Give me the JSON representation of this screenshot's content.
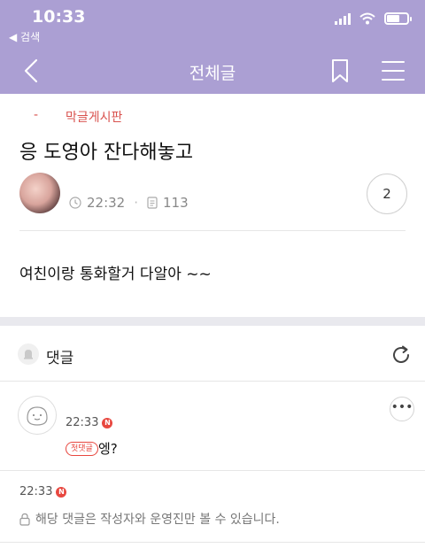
{
  "status_bar": {
    "time": "10:33",
    "back_app": "◀ 검색"
  },
  "navbar": {
    "title": "전체글"
  },
  "post": {
    "category_dash": "-",
    "category": "막글게시판",
    "title": "응 도영아 잔다해놓고",
    "time": "22:32",
    "views": "113",
    "comment_count": "2",
    "body": "여친이랑 통화할거 다알아 ~~"
  },
  "comments": {
    "header_label": "댓글",
    "items": [
      {
        "time": "22:33",
        "badge": "N",
        "first_label": "첫댓글",
        "text": "엥?",
        "more": "•••"
      },
      {
        "time": "22:33",
        "badge": "N",
        "text": "해당 댓글은 작성자와 운영진만 볼 수 있습니다."
      }
    ]
  },
  "colors": {
    "header_bg": "#ab9fd3",
    "accent_red": "#e8473f"
  }
}
